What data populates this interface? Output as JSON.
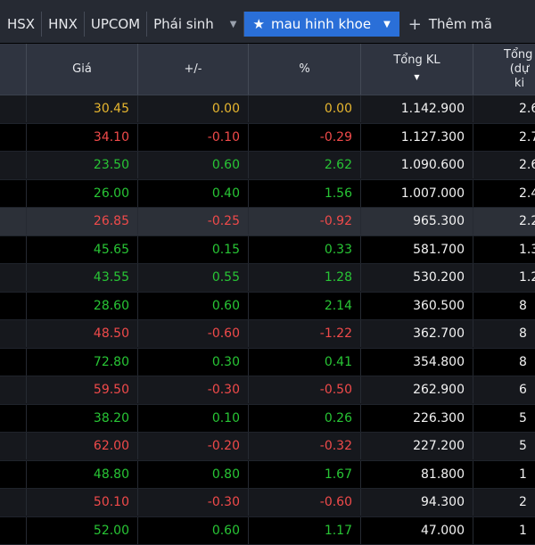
{
  "tabs": [
    {
      "label": "HSX"
    },
    {
      "label": "HNX"
    },
    {
      "label": "UPCOM"
    },
    {
      "label": "Phái sinh"
    }
  ],
  "active_tab": {
    "label": "mau hinh khoe",
    "icon": "star-icon"
  },
  "add_tab": {
    "label": "Thêm mã"
  },
  "columns": {
    "price": "Giá",
    "change": "+/-",
    "pct": "%",
    "volume": "Tổng KL",
    "next_line1": "Tổng",
    "next_line2": "(dự ki"
  },
  "rows": [
    {
      "price": "30.45",
      "change": "0.00",
      "pct": "0.00",
      "volume": "1.142.900",
      "next": "2.6",
      "dir": "ref"
    },
    {
      "price": "34.10",
      "change": "-0.10",
      "pct": "-0.29",
      "volume": "1.127.300",
      "next": "2.7",
      "dir": "down"
    },
    {
      "price": "23.50",
      "change": "0.60",
      "pct": "2.62",
      "volume": "1.090.600",
      "next": "2.6",
      "dir": "up"
    },
    {
      "price": "26.00",
      "change": "0.40",
      "pct": "1.56",
      "volume": "1.007.000",
      "next": "2.4",
      "dir": "up"
    },
    {
      "price": "26.85",
      "change": "-0.25",
      "pct": "-0.92",
      "volume": "965.300",
      "next": "2.2",
      "dir": "down"
    },
    {
      "price": "45.65",
      "change": "0.15",
      "pct": "0.33",
      "volume": "581.700",
      "next": "1.3",
      "dir": "up"
    },
    {
      "price": "43.55",
      "change": "0.55",
      "pct": "1.28",
      "volume": "530.200",
      "next": "1.2",
      "dir": "up"
    },
    {
      "price": "28.60",
      "change": "0.60",
      "pct": "2.14",
      "volume": "360.500",
      "next": "8",
      "dir": "up"
    },
    {
      "price": "48.50",
      "change": "-0.60",
      "pct": "-1.22",
      "volume": "362.700",
      "next": "8",
      "dir": "down"
    },
    {
      "price": "72.80",
      "change": "0.30",
      "pct": "0.41",
      "volume": "354.800",
      "next": "8",
      "dir": "up"
    },
    {
      "price": "59.50",
      "change": "-0.30",
      "pct": "-0.50",
      "volume": "262.900",
      "next": "6",
      "dir": "down"
    },
    {
      "price": "38.20",
      "change": "0.10",
      "pct": "0.26",
      "volume": "226.300",
      "next": "5",
      "dir": "up"
    },
    {
      "price": "62.00",
      "change": "-0.20",
      "pct": "-0.32",
      "volume": "227.200",
      "next": "5",
      "dir": "down"
    },
    {
      "price": "48.80",
      "change": "0.80",
      "pct": "1.67",
      "volume": "81.800",
      "next": "1",
      "dir": "up"
    },
    {
      "price": "50.10",
      "change": "-0.30",
      "pct": "-0.60",
      "volume": "94.300",
      "next": "2",
      "dir": "down"
    },
    {
      "price": "52.00",
      "change": "0.60",
      "pct": "1.17",
      "volume": "47.000",
      "next": "1",
      "dir": "up"
    }
  ],
  "colors": {
    "up": "#28c535",
    "down": "#f04a4a",
    "reference": "#e7b62f",
    "active_tab": "#2a6fd8"
  }
}
